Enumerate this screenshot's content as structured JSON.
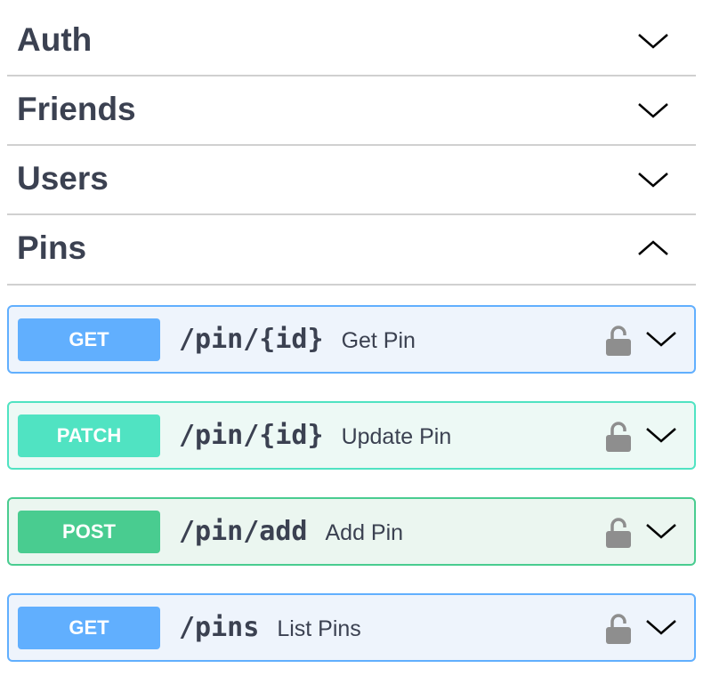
{
  "sections": [
    {
      "name": "Auth",
      "expanded": false
    },
    {
      "name": "Friends",
      "expanded": false
    },
    {
      "name": "Users",
      "expanded": false
    },
    {
      "name": "Pins",
      "expanded": true
    }
  ],
  "operations": [
    {
      "method": "GET",
      "path": "/pin/{id}",
      "summary": "Get Pin",
      "icon": "lock-icon"
    },
    {
      "method": "PATCH",
      "path": "/pin/{id}",
      "summary": "Update Pin",
      "icon": "lock-icon"
    },
    {
      "method": "POST",
      "path": "/pin/add",
      "summary": "Add Pin",
      "icon": "lock-icon"
    },
    {
      "method": "GET",
      "path": "/pins",
      "summary": "List Pins",
      "icon": "lock-icon"
    }
  ],
  "colors": {
    "get": "#61affe",
    "patch": "#50e3c2",
    "post": "#49cc90",
    "text": "#3b4151"
  }
}
